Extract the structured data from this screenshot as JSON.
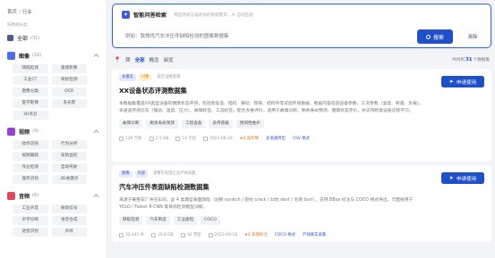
{
  "sidebar": {
    "crumb": [
      "首页",
      "行业"
    ],
    "subtitle": "按数据分类",
    "all": {
      "label": "全部",
      "count": "(31)"
    },
    "categories": [
      {
        "name": "图像",
        "count": "(16)",
        "color": "#4e6be8",
        "tags": [
          "缺陷检测",
          "遥感影像",
          "工业CT",
          "目标检测",
          "图像分类",
          "OCR",
          "医学影像",
          "多光谱",
          "3D点云"
        ]
      },
      {
        "name": "视频",
        "count": "(9)",
        "color": "#9a3fd4",
        "tags": [
          "动作识别",
          "行为分析",
          "视频跟踪",
          "安防监控",
          "作业检测",
          "自动驾驶",
          "操作识别",
          "3D关键点"
        ]
      },
      {
        "name": "音频",
        "count": "(6)",
        "color": "#e0455a",
        "tags": [
          "工业声音",
          "振动信号",
          "声学诊断",
          "语音合成",
          "语音识别",
          "声纹"
        ]
      }
    ]
  },
  "search": {
    "title": "智能问答检索",
    "hint": "用自然语言描述你的数据需求，AI 自动匹配",
    "placeholder": "例如：我想找汽车冲压件缺陷检测的图像数据集",
    "button": "搜索",
    "clear": "清除"
  },
  "filters": {
    "prefix": "筛",
    "items": [
      "全部",
      "概念",
      "阅览"
    ],
    "active_index": 0,
    "total_prefix": "共找到",
    "total_count": "31",
    "total_suffix": "个数据集"
  },
  "cards": [
    {
      "type_badge": "多模态",
      "vip_badge": "付费",
      "source": "安全运维监测",
      "title": "XX设备状态评测数据集",
      "desc": "本数据集覆盖XX类型设备的健康状态评测，包括高低温、电机、振动、频率、结构件等试验环境数据，数据内容包括设备参数、工况参数（温度、转速、负载）、多通道传感信号（振动、温度、压力）、故障标签、工况标签，配合多维评价，适用于故障诊断、剩余寿命预测、健康状态评价，并支持跨类设备迁移学习。",
      "chips": [
        "故障诊断",
        "剩余寿命预测",
        "工程设备",
        "多传感器",
        "预测性维护"
      ],
      "meta": [
        "128 万条",
        "2.5 GB",
        "14 字段",
        "2023-06-20",
        "★3 高阶降",
        "多值通用型",
        "CSV 格式"
      ],
      "apply": "申请使用"
    },
    {
      "type_badge": "图像",
      "vip_badge": "内部",
      "source": "某整车制造企业产线采集",
      "title": "汽车冲压件表面缺陷检测数据集",
      "desc": "来源于某整车厂冲压车间，含 4 类典型表面缺陷（划痕 scratch / 裂纹 crack / 凹坑 dent / 毛刺 burr），支持 BBox 标注与 COCO 格式导出，可直接用于 YOLO / Faster R-CNN 等目标检测模型训练。",
      "chips": [
        "缺陷检测",
        "汽车制造",
        "工业质检",
        "COCO"
      ],
      "meta": [
        "32,445 条",
        "16.8 GB",
        "10 字段",
        "2023-09-18",
        "★4 高频标注",
        "COCO 格式",
        "产线真实采集"
      ],
      "apply": "申请使用"
    }
  ]
}
